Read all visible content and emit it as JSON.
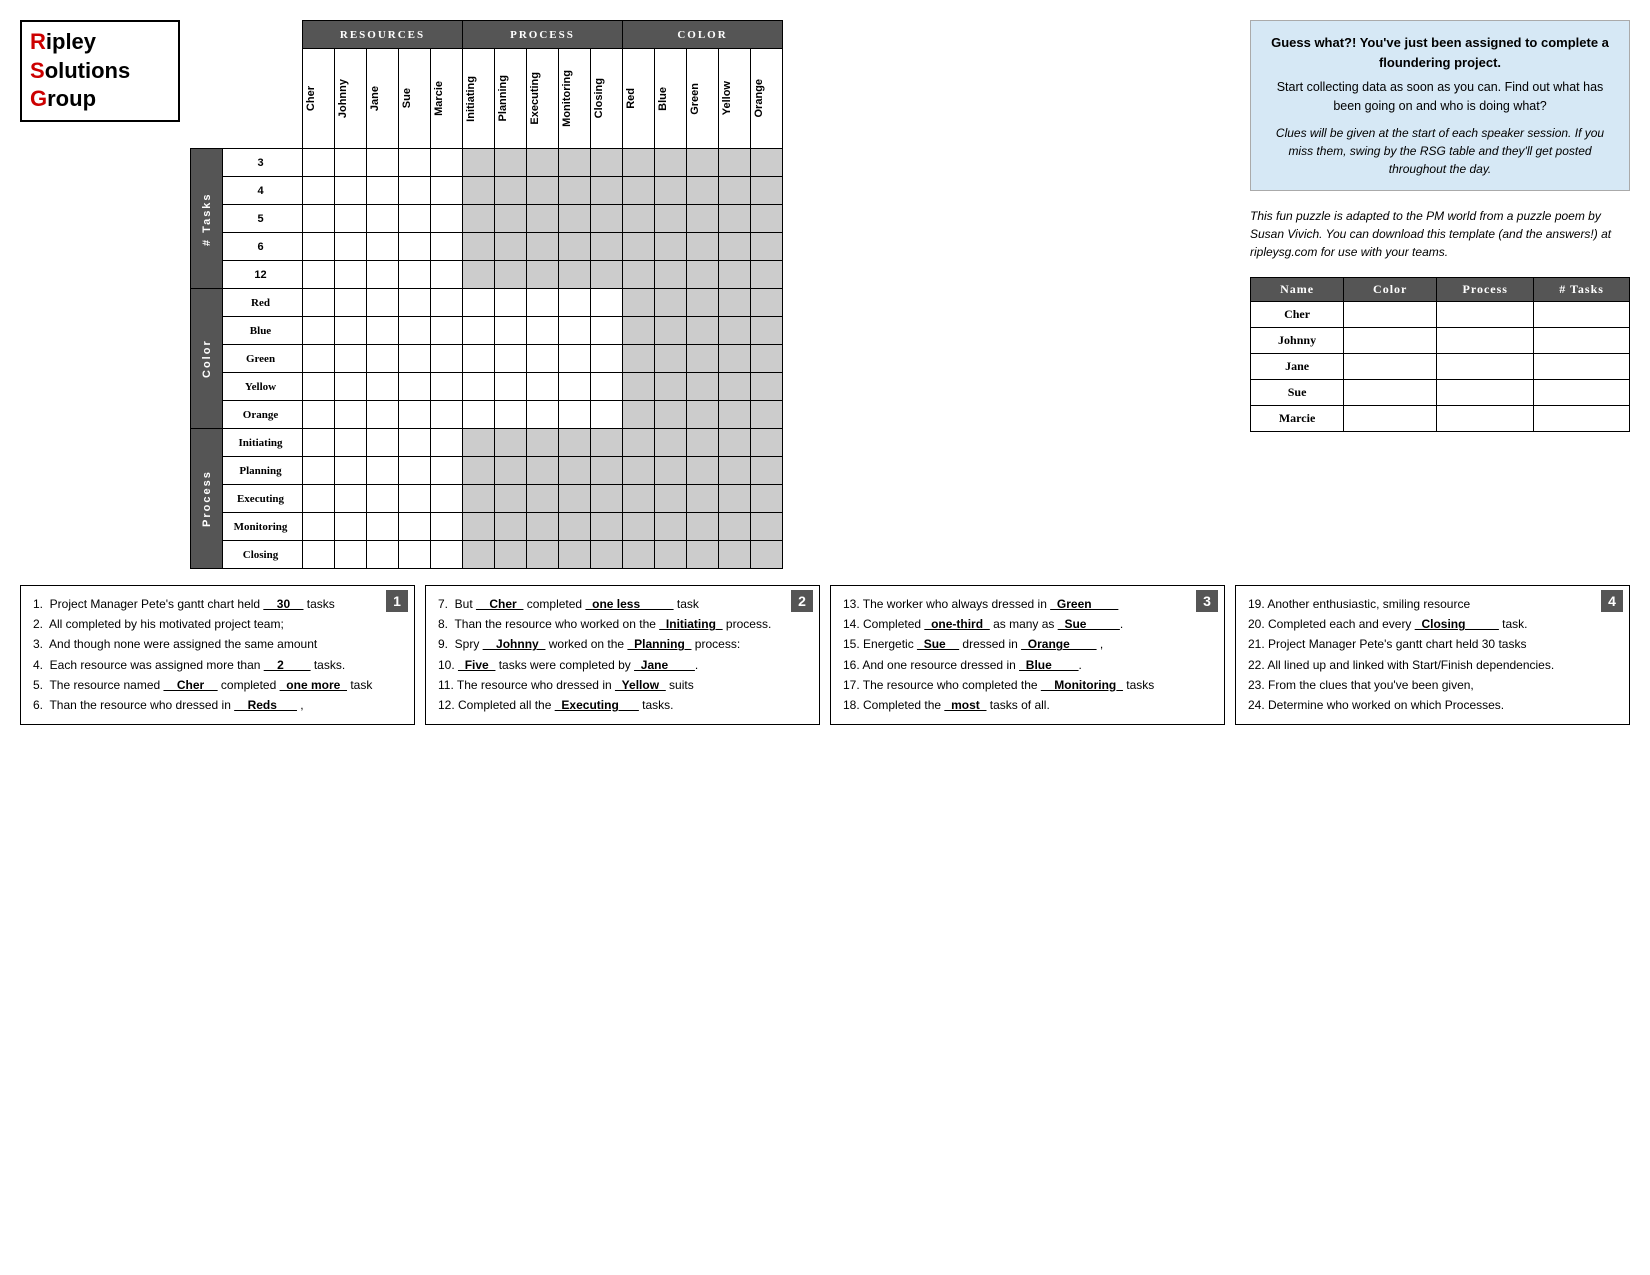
{
  "logo": {
    "line1": "ipley",
    "line2": "olutions",
    "line3": "roup",
    "r": "R",
    "s": "S",
    "g": "G"
  },
  "headers": {
    "resources": "Resources",
    "process": "Process",
    "color": "Color",
    "resources_cols": [
      "Cher",
      "Johnny",
      "Jane",
      "Sue",
      "Marcie"
    ],
    "process_cols": [
      "Initiating",
      "Planning",
      "Executing",
      "Monitoring",
      "Closing"
    ],
    "color_cols": [
      "Red",
      "Blue",
      "Green",
      "Yellow",
      "Orange"
    ]
  },
  "row_sections": {
    "tasks_label": "# Tasks",
    "color_label": "Color",
    "process_label": "Process"
  },
  "task_rows": [
    "3",
    "4",
    "5",
    "6",
    "12"
  ],
  "color_rows": [
    "Red",
    "Blue",
    "Green",
    "Yellow",
    "Orange"
  ],
  "process_rows": [
    "Initiating",
    "Planning",
    "Executing",
    "Monitoring",
    "Closing"
  ],
  "info": {
    "title": "Guess what?! You've just been assigned to complete a floundering project.",
    "subtitle": "Start collecting data as soon as you can.  Find out what has been going on and who is doing what?",
    "clue_text": "Clues will be given at the start of each speaker session.  If you miss them, swing by the RSG table and they'll get posted throughout the day.",
    "italic_text": "This fun puzzle is adapted to the PM world from a puzzle poem by Susan Vivich.  You can download this template (and the answers!) at ripleysg.com for use with your teams."
  },
  "summary_table": {
    "headers": [
      "Name",
      "Color",
      "Process",
      "# Tasks"
    ],
    "rows": [
      {
        "name": "Cher"
      },
      {
        "name": "Johnny"
      },
      {
        "name": "Jane"
      },
      {
        "name": "Sue"
      },
      {
        "name": "Marcie"
      }
    ]
  },
  "clues": {
    "box1": [
      "1.  Project Manager Pete's gantt chart held __30__ tasks",
      "2.  All completed by his motivated project team;",
      "3.  And though none were assigned the same amount",
      "4.  Each resource was assigned more than __2____ tasks.",
      "5.  The resource named __Cher__ completed _one more_ task",
      "6.  Than the resource who dressed in __Reds___ ,"
    ],
    "box2": [
      "7.  But __Cher_ completed _one less_____ task",
      "8.  Than the resource who worked on the _Initiating_ process.",
      "9.  Spry __Johnny_ worked on the _Planning_ process:",
      "10. _Five_ tasks were completed by _Jane____.",
      "11. The resource who dressed in _Yellow_ suits",
      "12. Completed all the _Executing___ tasks."
    ],
    "box3": [
      "13. The worker who always dressed in _Green____",
      "14. Completed _one-third_ as many as _Sue_____.",
      "15. Energetic _Sue__ dressed in _Orange____ ,",
      "16. And one resource dressed in _Blue____.",
      "17. The resource who completed the __Monitoring_ tasks",
      "18. Completed the _most_ tasks of all."
    ],
    "box4": [
      "19. Another enthusiastic, smiling resource",
      "20. Completed each and every _Closing____ task.",
      "21. Project Manager Pete's gantt chart held 30 tasks",
      "22. All lined up and linked with Start/Finish dependencies.",
      "23. From the clues that you've been given,",
      "24. Determine who worked on which Processes."
    ]
  }
}
